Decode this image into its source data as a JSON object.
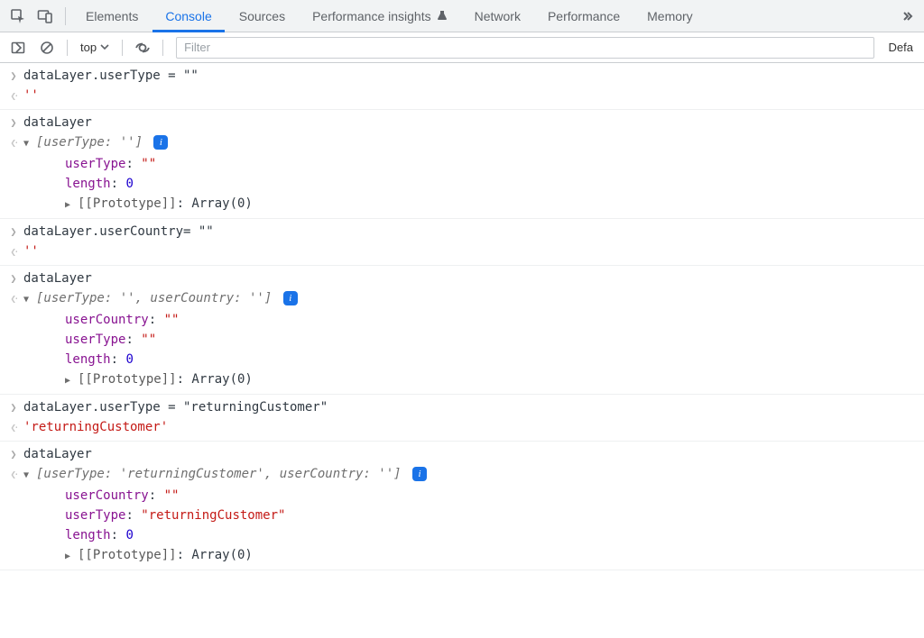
{
  "tabs": {
    "elements": "Elements",
    "console": "Console",
    "sources": "Sources",
    "perf_insights": "Performance insights",
    "network": "Network",
    "performance": "Performance",
    "memory": "Memory"
  },
  "toolbar": {
    "context": "top",
    "filter_placeholder": "Filter",
    "levels": "Defa"
  },
  "badge": {
    "info": "i"
  },
  "entries": [
    {
      "input": "dataLayer.userType = \"\"",
      "output_plain": "''"
    },
    {
      "input": "dataLayer",
      "preview": "[userType: '']",
      "props": [
        {
          "key": "userType",
          "val": "\"\"",
          "val_class": "tok-str"
        },
        {
          "key": "length",
          "val": "0",
          "val_class": "tok-num"
        }
      ],
      "proto": {
        "label": "[[Prototype]]",
        "val": "Array(0)"
      }
    },
    {
      "input": "dataLayer.userCountry= \"\"",
      "output_plain": "''"
    },
    {
      "input": "dataLayer",
      "preview": "[userType: '', userCountry: '']",
      "props": [
        {
          "key": "userCountry",
          "val": "\"\"",
          "val_class": "tok-str"
        },
        {
          "key": "userType",
          "val": "\"\"",
          "val_class": "tok-str"
        },
        {
          "key": "length",
          "val": "0",
          "val_class": "tok-num"
        }
      ],
      "proto": {
        "label": "[[Prototype]]",
        "val": "Array(0)"
      }
    },
    {
      "input": "dataLayer.userType = \"returningCustomer\"",
      "output_plain": "'returningCustomer'"
    },
    {
      "input": "dataLayer",
      "preview": "[userType: 'returningCustomer', userCountry: '']",
      "props": [
        {
          "key": "userCountry",
          "val": "\"\"",
          "val_class": "tok-str"
        },
        {
          "key": "userType",
          "val": "\"returningCustomer\"",
          "val_class": "tok-str"
        },
        {
          "key": "length",
          "val": "0",
          "val_class": "tok-num"
        }
      ],
      "proto": {
        "label": "[[Prototype]]",
        "val": "Array(0)"
      }
    }
  ]
}
